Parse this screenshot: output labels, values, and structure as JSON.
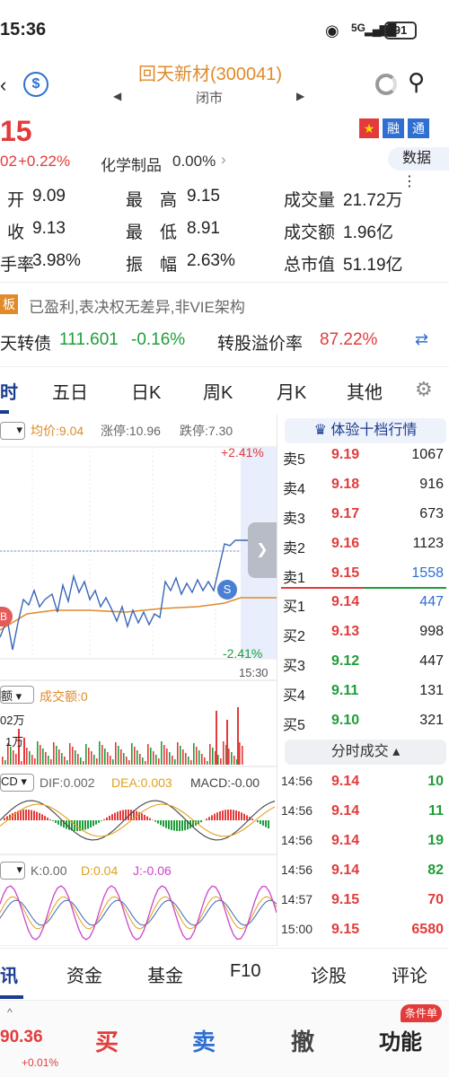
{
  "status": {
    "time": "15:36",
    "signal": "5G",
    "battery": "91"
  },
  "header": {
    "title": "回天新材(300041)",
    "subtitle": "闭市"
  },
  "tags": {
    "margin": "融",
    "connect": "通",
    "data": "数据"
  },
  "quote": {
    "price": "15",
    "change_left": "02",
    "change_pct": "+0.22%",
    "sector": "化学制品",
    "sector_pct": "0.00%",
    "open_label": "开",
    "open": "9.09",
    "high_label": "最　高",
    "high": "9.15",
    "vol_label": "成交量",
    "vol": "21.72万",
    "close_label": "收",
    "close": "9.13",
    "low_label": "最　低",
    "low": "8.91",
    "amt_label": "成交额",
    "amt": "1.96亿",
    "turn_label": "手率",
    "turn": "3.98%",
    "amp_label": "振　幅",
    "amp": "2.63%",
    "mcap_label": "总市值",
    "mcap": "51.19亿",
    "badge": "板",
    "note": "已盈利,表决权无差异,非VIE架构",
    "cb_label": "天转债",
    "cb_price": "111.601",
    "cb_pct": "-0.16%",
    "prem_label": "转股溢价率",
    "prem": "87.22%"
  },
  "tabs": [
    "时",
    "五日",
    "日K",
    "周K",
    "月K",
    "其他"
  ],
  "chart": {
    "sel": "▾",
    "avg": "均价:9.04",
    "up_limit": "涨停:10.96",
    "down_limit": "跌停:7.30",
    "pct_top": "+2.41%",
    "pct_bot": "-2.41%",
    "time_end": "15:30",
    "vol_sel": "额",
    "vol_label": "成交额:0",
    "vol_t1": "02万",
    "vol_t2": "1万",
    "macd_sel": "CD",
    "dif": "DIF:0.002",
    "dea": "DEA:0.003",
    "macd": "MACD:-0.00",
    "kdj_sel": "▾",
    "k": "K:0.00",
    "d": "D:0.04",
    "j": "J:-0.06",
    "s_mark": "S",
    "b_mark": "B"
  },
  "book": {
    "premium": "体验十档行情",
    "asks": [
      {
        "label": "卖5",
        "price": "9.19",
        "vol": "1067"
      },
      {
        "label": "卖4",
        "price": "9.18",
        "vol": "916"
      },
      {
        "label": "卖3",
        "price": "9.17",
        "vol": "673"
      },
      {
        "label": "卖2",
        "price": "9.16",
        "vol": "1123"
      },
      {
        "label": "卖1",
        "price": "9.15",
        "vol": "1558"
      }
    ],
    "bids": [
      {
        "label": "买1",
        "price": "9.14",
        "vol": "447"
      },
      {
        "label": "买2",
        "price": "9.13",
        "vol": "998"
      },
      {
        "label": "买3",
        "price": "9.12",
        "vol": "447"
      },
      {
        "label": "买4",
        "price": "9.11",
        "vol": "131"
      },
      {
        "label": "买5",
        "price": "9.10",
        "vol": "321"
      }
    ],
    "ticks_label": "分时成交",
    "ticks": [
      {
        "t": "14:56",
        "p": "9.14",
        "v": "10"
      },
      {
        "t": "14:56",
        "p": "9.14",
        "v": "11"
      },
      {
        "t": "14:56",
        "p": "9.14",
        "v": "19"
      },
      {
        "t": "14:56",
        "p": "9.14",
        "v": "82"
      },
      {
        "t": "14:57",
        "p": "9.15",
        "v": "70"
      },
      {
        "t": "15:00",
        "p": "9.15",
        "v": "6580"
      }
    ]
  },
  "bottom_tabs": [
    "讯",
    "资金",
    "基金",
    "F10",
    "诊股",
    "评论"
  ],
  "actions": {
    "index": "90.36",
    "index_pct": "+0.01%",
    "buy": "买",
    "sell": "卖",
    "cancel": "撤",
    "func": "功能",
    "badge": "条件单"
  },
  "colors": {
    "up": "#e33b3b",
    "down": "#1f9d3a",
    "accent": "#2e6fd1",
    "price_line": "#3a66b7",
    "avg_line": "#e08a2a"
  }
}
